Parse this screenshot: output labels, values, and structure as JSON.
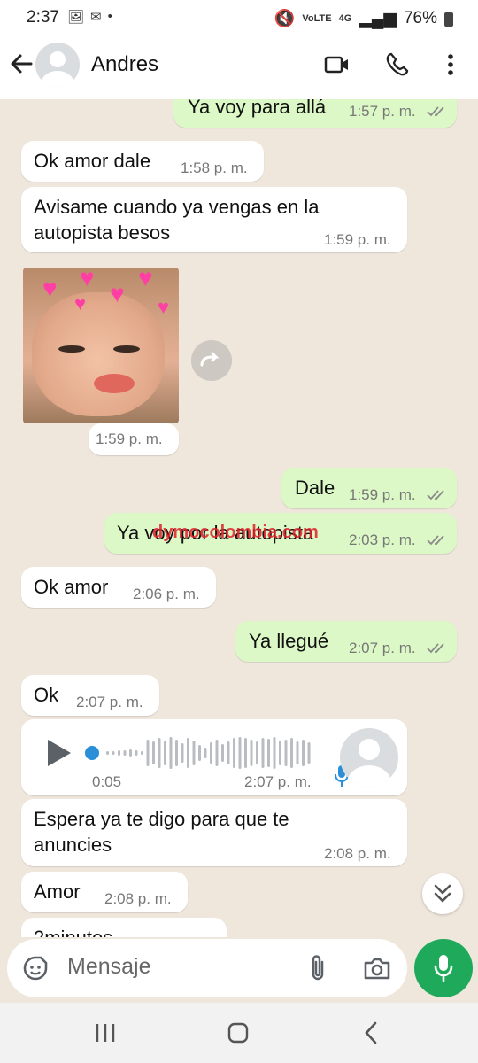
{
  "status": {
    "time": "2:37",
    "battery": "76%",
    "network": "4G",
    "volte": "VoLTE"
  },
  "header": {
    "contact_name": "Andres"
  },
  "messages": [
    {
      "dir": "out",
      "text": "Ya voy para allá",
      "time": "1:57 p. m."
    },
    {
      "dir": "in",
      "text": "Ok amor dale",
      "time": "1:58 p. m."
    },
    {
      "dir": "in",
      "text": "Avisame cuando ya vengas en la autopista besos",
      "time": "1:59 p. m."
    },
    {
      "dir": "in",
      "type": "image",
      "time": "1:59 p. m."
    },
    {
      "dir": "out",
      "text": "Dale",
      "time": "1:59 p. m."
    },
    {
      "dir": "out",
      "text": "Ya voy por la autopista",
      "time": "2:03 p. m."
    },
    {
      "dir": "in",
      "text": "Ok amor",
      "time": "2:06 p. m."
    },
    {
      "dir": "out",
      "text": "Ya llegué",
      "time": "2:07 p. m."
    },
    {
      "dir": "in",
      "text": "Ok",
      "time": "2:07 p. m."
    },
    {
      "dir": "in",
      "type": "voice",
      "duration": "0:05",
      "time": "2:07 p. m."
    },
    {
      "dir": "in",
      "text": "Espera ya te digo para que te anuncies",
      "time": "2:08 p. m."
    },
    {
      "dir": "in",
      "text": "Amor",
      "time": "2:08 p. m."
    },
    {
      "dir": "in",
      "text": "2minutos",
      "time": ""
    }
  ],
  "watermark": "dymocolombia.com",
  "input": {
    "placeholder": "Mensaje"
  },
  "colors": {
    "outgoing": "#dcf8c6",
    "incoming": "#ffffff",
    "accent": "#1faa5b",
    "wallpaper": "#efe7dc"
  }
}
